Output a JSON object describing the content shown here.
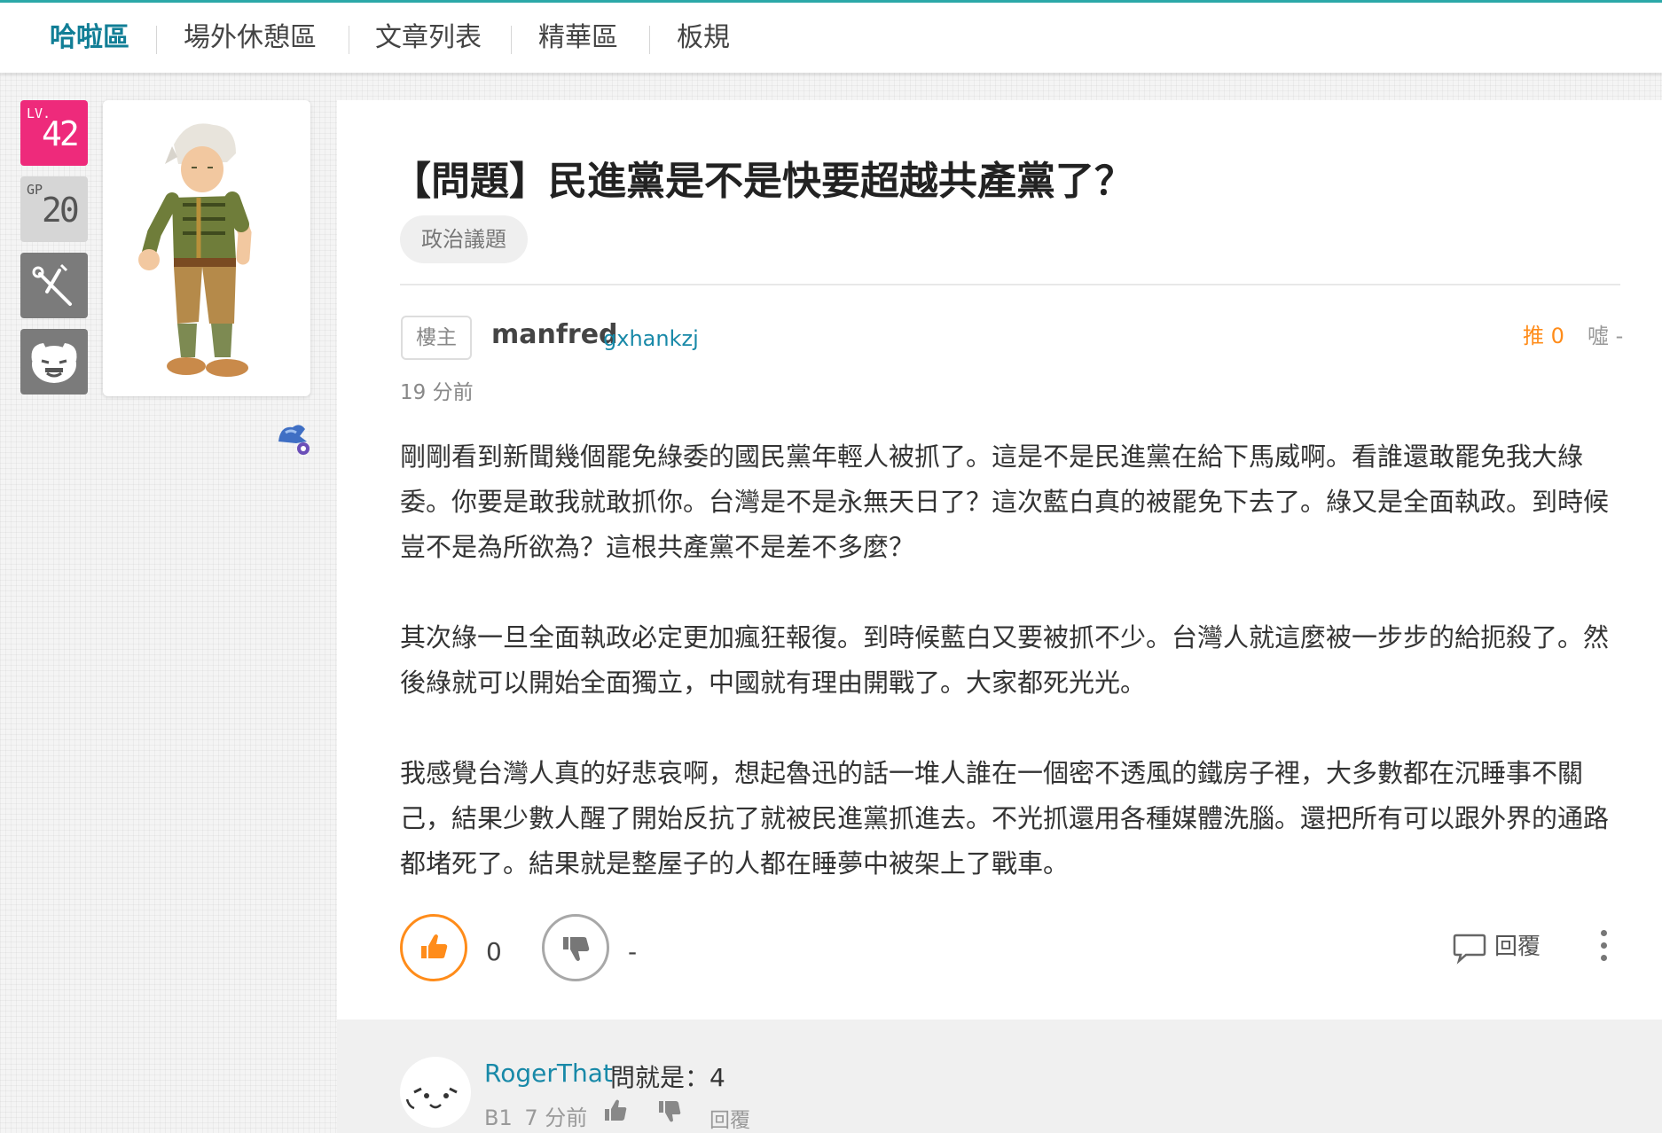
{
  "nav": {
    "items": [
      {
        "label": "哈啦區",
        "active": true
      },
      {
        "label": "場外休憩區"
      },
      {
        "label": "文章列表"
      },
      {
        "label": "精華區"
      },
      {
        "label": "板規"
      }
    ]
  },
  "sidebar": {
    "lv_label": "LV.",
    "lv_value": "42",
    "gp_label": "GP",
    "gp_value": "20"
  },
  "post": {
    "title": "【問題】民進黨是不是快要超越共產黨了？",
    "tag": "政治議題",
    "role": "樓主",
    "author_name": "manfred",
    "author_id": "gxhankzj",
    "push_label": "推 0",
    "boo_label": "噓 -",
    "time": "19 分前",
    "paragraphs": [
      "剛剛看到新聞幾個罷免綠委的國民黨年輕人被抓了。這是不是民進黨在給下馬威啊。看誰還敢罷免我大綠委。你要是敢我就敢抓你。台灣是不是永無天日了？這次藍白真的被罷免下去了。綠又是全面執政。到時候豈不是為所欲為？這根共產黨不是差不多麼？",
      "其次綠一旦全面執政必定更加瘋狂報復。到時候藍白又要被抓不少。台灣人就這麼被一步步的給扼殺了。然後綠就可以開始全面獨立，中國就有理由開戰了。大家都死光光。",
      "我感覺台灣人真的好悲哀啊，想起魯迅的話一堆人誰在一個密不透風的鐵房子裡，大多數都在沉睡事不關己，結果少數人醒了開始反抗了就被民進黨抓進去。不光抓還用各種媒體洗腦。還把所有可以跟外界的通路都堵死了。結果就是整屋子的人都在睡夢中被架上了戰車。"
    ],
    "like_count": "0",
    "dislike_count": "-",
    "reply_label": "回覆"
  },
  "comment": {
    "user": "RogerThat",
    "text": "問就是：4",
    "floor": "B1",
    "time": "7 分前",
    "reply_label": "回覆"
  },
  "colors": {
    "accent_teal": "#117e96",
    "link_blue": "#1889a8",
    "push_orange": "#ff8c1a",
    "lv_pink": "#ee2a7b"
  },
  "icons": {
    "like": "thumbs-up-icon",
    "dislike": "thumbs-down-icon",
    "reply": "speech-bubble-icon",
    "more": "vertical-dots-icon",
    "tool": "tool-icon",
    "face": "mascot-face-icon"
  }
}
